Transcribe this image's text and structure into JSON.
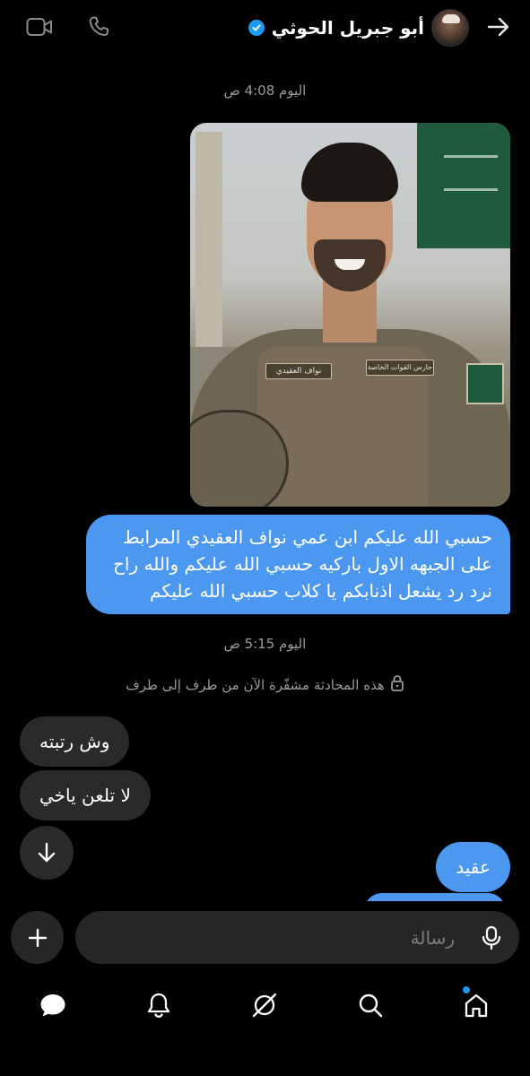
{
  "header": {
    "contact_name": "أبو جبريل الحوثي",
    "verified": true,
    "icons": [
      "back-arrow-icon",
      "video-call-icon",
      "phone-call-icon",
      "verified-badge-icon"
    ]
  },
  "conversation": {
    "timestamp_1": "اليوم 4:08 ص",
    "outgoing_long": "حسبي الله عليكم ابن عمي نواف العقيدي المرابط على الجبهه الاول باركيه حسبي الله عليكم والله راح نرد رد يشعل اذنابكم يا كلاب حسبي الله عليكم",
    "timestamp_2": "اليوم 5:15 ص",
    "encryption_note": "هذه المحادثة مشفّرة الآن من طرف إلى طرف",
    "incoming_1": "وش رتبته",
    "incoming_2": "لا تلعن ياخي",
    "outgoing_short": "عقيد",
    "photo_badges": {
      "name_tag": "نواف العقيدي",
      "unit_tag": "حارس القوات الخاصة"
    }
  },
  "composer": {
    "placeholder": "رسالة"
  },
  "bottom_nav": {
    "items": [
      "home-icon",
      "search-icon",
      "grok-icon",
      "notifications-icon",
      "messages-icon"
    ],
    "active": "messages-icon"
  },
  "colors": {
    "background": "#000000",
    "outgoing_bubble": "#4c97f0",
    "incoming_bubble": "#2a2a2a",
    "accent": "#1d9bf0",
    "muted_text": "#9a9a9a"
  }
}
